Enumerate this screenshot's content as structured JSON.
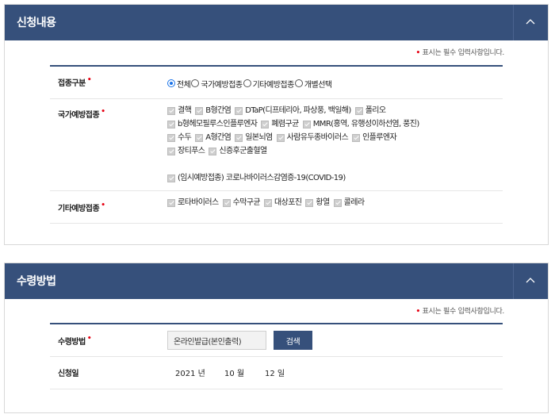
{
  "panel1": {
    "title": "신청내용",
    "required_note": "표시는 필수 입력사항입니다.",
    "vaccine_type": {
      "label": "접종구분",
      "options": [
        {
          "label": "전체",
          "checked": true
        },
        {
          "label": "국가예방접종",
          "checked": false
        },
        {
          "label": "기타예방접종",
          "checked": false
        },
        {
          "label": "개별선택",
          "checked": false
        }
      ]
    },
    "national": {
      "label": "국가예방접종",
      "lines": [
        [
          "결핵",
          "B형간염",
          "DTaP(디프테리아, 파상풍, 백일해)",
          "폴리오"
        ],
        [
          "b형헤모필루스인플루엔자",
          "폐렴구균",
          "MMR(홍역, 유행성이하선염, 풍진)"
        ],
        [
          "수두",
          "A형간염",
          "일본뇌염",
          "사람유두종바이러스",
          "인플루엔자"
        ],
        [
          "장티푸스",
          "신증후군출혈열"
        ],
        [],
        [
          "(임시예방접종) 코로나바이러스감염증-19(COVID-19)"
        ]
      ]
    },
    "other": {
      "label": "기타예방접종",
      "items": [
        "로타바이러스",
        "수막구균",
        "대상포진",
        "황열",
        "콜레라"
      ]
    }
  },
  "panel2": {
    "title": "수령방법",
    "required_note": "표시는 필수 입력사항입니다.",
    "method": {
      "label": "수령방법",
      "value": "온라인발급(본인출력)",
      "search_label": "검색"
    },
    "date": {
      "label": "신청일",
      "year": "2021 년",
      "month": "10 월",
      "day": "12 일"
    }
  },
  "colors": {
    "header": "#36507b",
    "required": "#e60012",
    "radio_checked": "#1a73e8"
  },
  "icons": {
    "collapse": "chevron-up-icon",
    "required": "required-dot-icon"
  }
}
